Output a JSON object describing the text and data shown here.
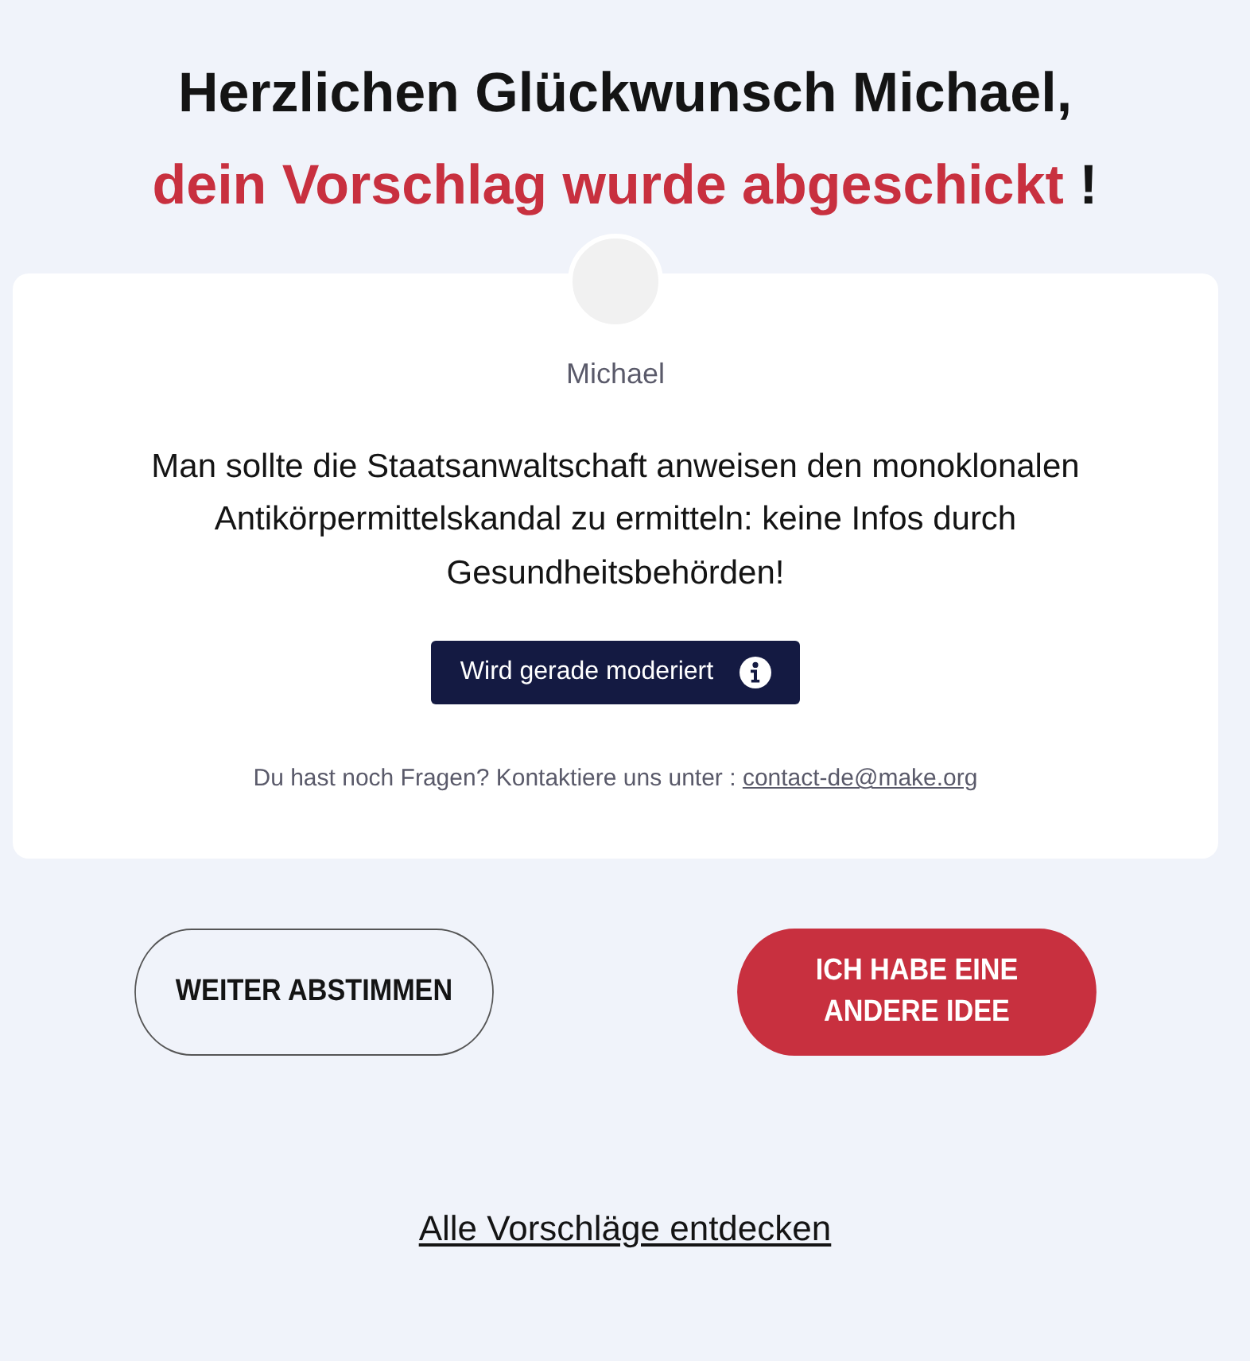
{
  "heading": {
    "line_1": "Herzlichen Glückwunsch Michael,",
    "line_2_highlight": "dein Vorschlag wurde abgeschickt",
    "line_2_end": "!"
  },
  "proposal": {
    "author": "Michael",
    "text": "Man sollte die Staatsanwaltschaft anweisen den monoklonalen Antikörpermittelskandal zu ermitteln: keine Infos durch Gesundheitsbehörden!",
    "status": "Wird gerade moderiert",
    "contact_text": "Du hast noch Fragen? Kontaktiere uns unter :",
    "contact_email": "contact-de@make.org"
  },
  "buttons": [
    {
      "label": "WEITER ABSTIMMEN",
      "kind": "outline"
    },
    {
      "label": "ICH HABE EINE ANDERE IDEE",
      "kind": "filled"
    }
  ],
  "footer_link": "Alle Vorschläge entdecken"
}
